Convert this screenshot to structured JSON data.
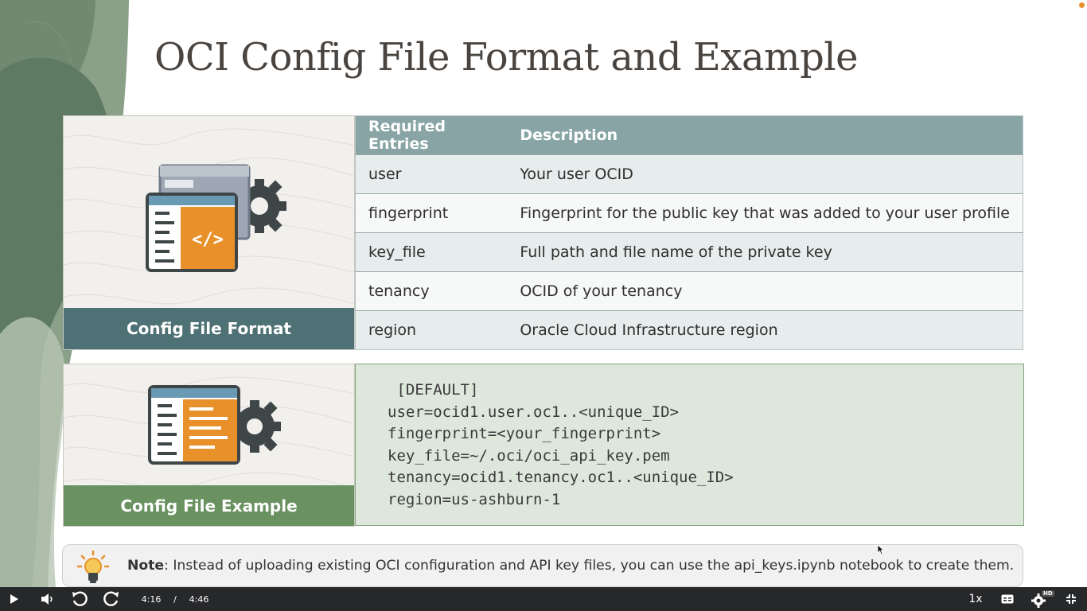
{
  "slide": {
    "title": "OCI Config File Format and Example",
    "format_label": "Config File Format",
    "example_label": "Config File Example"
  },
  "table": {
    "headers": [
      "Required Entries",
      "Description"
    ],
    "rows": [
      {
        "entry": "user",
        "description": "Your user OCID"
      },
      {
        "entry": "fingerprint",
        "description": "Fingerprint for the public key that was added to your user profile"
      },
      {
        "entry": "key_file",
        "description": "Full path and file name of the private key"
      },
      {
        "entry": "tenancy",
        "description": "OCID of your tenancy"
      },
      {
        "entry": "region",
        "description": "Oracle Cloud Infrastructure region"
      }
    ]
  },
  "code": {
    "lines": [
      " [DEFAULT]",
      "user=ocid1.user.oc1..<unique_ID>",
      "fingerprint=<your_fingerprint>",
      "key_file=~/.oci/oci_api_key.pem",
      "tenancy=ocid1.tenancy.oc1..<unique_ID>",
      "region=us-ashburn-1"
    ]
  },
  "note": {
    "label": "Note",
    "text": ": Instead of uploading existing OCI configuration and API key files, you can use the api_keys.ipynb notebook to create them."
  },
  "player": {
    "current_time": "4:16",
    "separator": "/",
    "duration": "4:46",
    "speed": "1x",
    "quality_badge": "HD",
    "icons": [
      "play-icon",
      "volume-icon",
      "rewind-icon",
      "forward-icon",
      "captions-icon",
      "settings-icon",
      "exit-fullscreen-icon"
    ]
  },
  "colors": {
    "format_bar": "#4e7175",
    "example_bar": "#6a9160",
    "table_header": "#88a4a4",
    "code_bg": "#dde7dc",
    "accent_orange": "#e8912a"
  }
}
